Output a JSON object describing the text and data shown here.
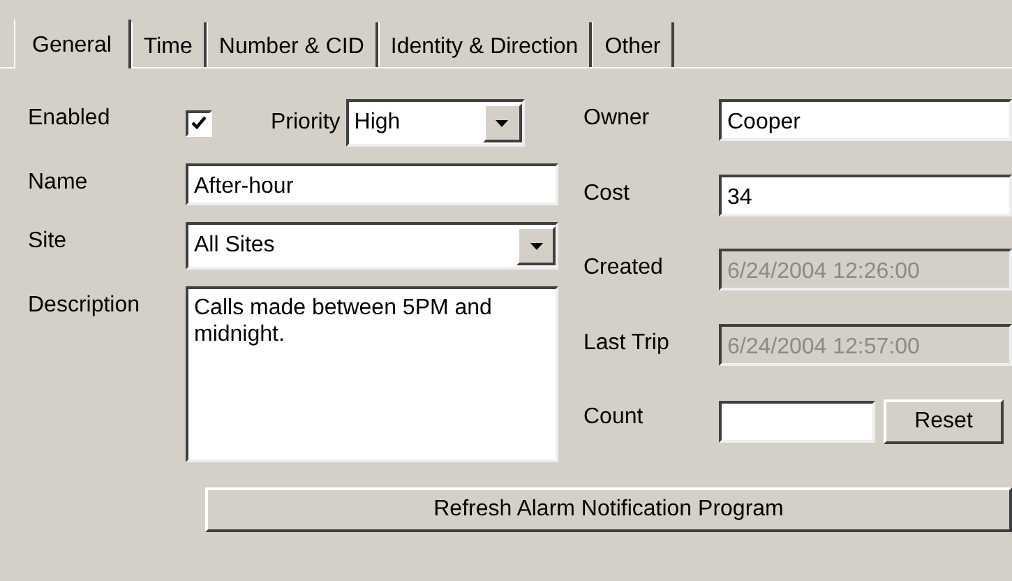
{
  "tabs": [
    {
      "label": "General",
      "selected": true
    },
    {
      "label": "Time",
      "selected": false
    },
    {
      "label": "Number & CID",
      "selected": false
    },
    {
      "label": "Identity & Direction",
      "selected": false
    },
    {
      "label": "Other",
      "selected": false
    }
  ],
  "enabled": {
    "label": "Enabled",
    "checked": true
  },
  "priority": {
    "label": "Priority",
    "value": "High"
  },
  "name": {
    "label": "Name",
    "value": "After-hour"
  },
  "site": {
    "label": "Site",
    "value": "All Sites"
  },
  "description": {
    "label": "Description",
    "value": "Calls made between 5PM and midnight."
  },
  "owner": {
    "label": "Owner",
    "value": "Cooper"
  },
  "cost": {
    "label": "Cost",
    "value": "34"
  },
  "created": {
    "label": "Created",
    "value": "6/24/2004 12:26:00",
    "disabled": true
  },
  "last_trip": {
    "label": "Last Trip",
    "value": "6/24/2004 12:57:00",
    "disabled": true
  },
  "count": {
    "label": "Count",
    "button": "Reset"
  },
  "refresh_button": "Refresh Alarm Notification Program"
}
